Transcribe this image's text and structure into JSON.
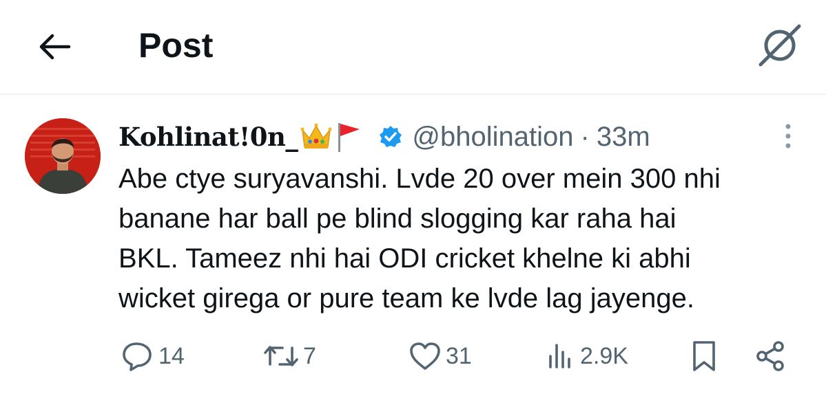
{
  "header": {
    "title": "Post",
    "back_icon": "arrow-left-icon",
    "grok_icon": "grok-icon"
  },
  "tweet": {
    "display_name": "Kohlinat!0n_",
    "name_emojis": [
      "crown-icon",
      "red-flag-icon"
    ],
    "verified": true,
    "handle": "@bholination",
    "separator": "·",
    "time": "33m",
    "text_lines": [
      "Abe ctye suryavanshi. Lvde 20 over mein 300 nhi",
      "banane har ball pe blind slogging kar raha hai",
      "BKL. Tameez nhi hai ODI cricket khelne ki abhi",
      "wicket girega or pure team ke lvde lag jayenge."
    ]
  },
  "actions": {
    "replies": "14",
    "reposts": "7",
    "likes": "31",
    "views": "2.9K"
  },
  "colors": {
    "text": "#0f1419",
    "secondary": "#536471",
    "verified": "#1d9bf0",
    "divider": "#eff3f4",
    "avatar_bg": "#c62017"
  }
}
